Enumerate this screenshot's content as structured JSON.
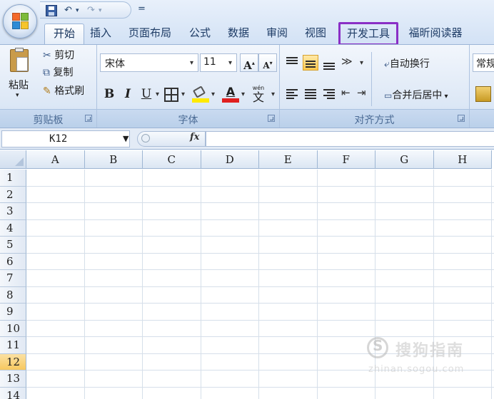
{
  "quick_access": {
    "save_icon": "save-icon",
    "undo_glyph": "↶",
    "redo_glyph": "↷",
    "dropdown_glyph": "▾",
    "customize_glyph": "₹"
  },
  "tabs": [
    {
      "label": "开始",
      "active": true
    },
    {
      "label": "插入"
    },
    {
      "label": "页面布局"
    },
    {
      "label": "公式"
    },
    {
      "label": "数据"
    },
    {
      "label": "审阅"
    },
    {
      "label": "视图"
    },
    {
      "label": "开发工具",
      "highlighted": true,
      "highlight_color": "#8a2fc6"
    },
    {
      "label": "福昕阅读器"
    }
  ],
  "clipboard": {
    "group_label": "剪贴板",
    "paste_label": "粘贴",
    "cut_label": "剪切",
    "copy_label": "复制",
    "format_painter_label": "格式刷"
  },
  "font": {
    "group_label": "字体",
    "font_name": "宋体",
    "font_size": "11",
    "grow_label": "A",
    "shrink_label": "A",
    "bold": "B",
    "italic": "I",
    "underline": "U",
    "fill_color": "#ffea00",
    "font_color": "#e02020",
    "phonetic_label": "wén",
    "font_color_label": "A"
  },
  "alignment": {
    "group_label": "对齐方式",
    "wrap_text_label": "自动换行",
    "merge_center_label": "合并后居中",
    "selected_align": "middle"
  },
  "number": {
    "format_partial": "常规"
  },
  "formula_bar": {
    "name_box": "K12",
    "fx_label": "fx",
    "formula": ""
  },
  "sheet": {
    "columns": [
      "A",
      "B",
      "C",
      "D",
      "E",
      "F",
      "G",
      "H"
    ],
    "rows": [
      "1",
      "2",
      "3",
      "4",
      "5",
      "6",
      "7",
      "8",
      "9",
      "10",
      "11",
      "12",
      "13",
      "14"
    ],
    "selected_row": "12",
    "selected_cell": "K12"
  },
  "watermark": {
    "text": "搜狗指南",
    "url": "zhinan.sogou.com"
  },
  "colors": {
    "accent": "#8a2fc6",
    "ribbon": "#dde8f6",
    "row_highlight": "#f7c85f"
  }
}
